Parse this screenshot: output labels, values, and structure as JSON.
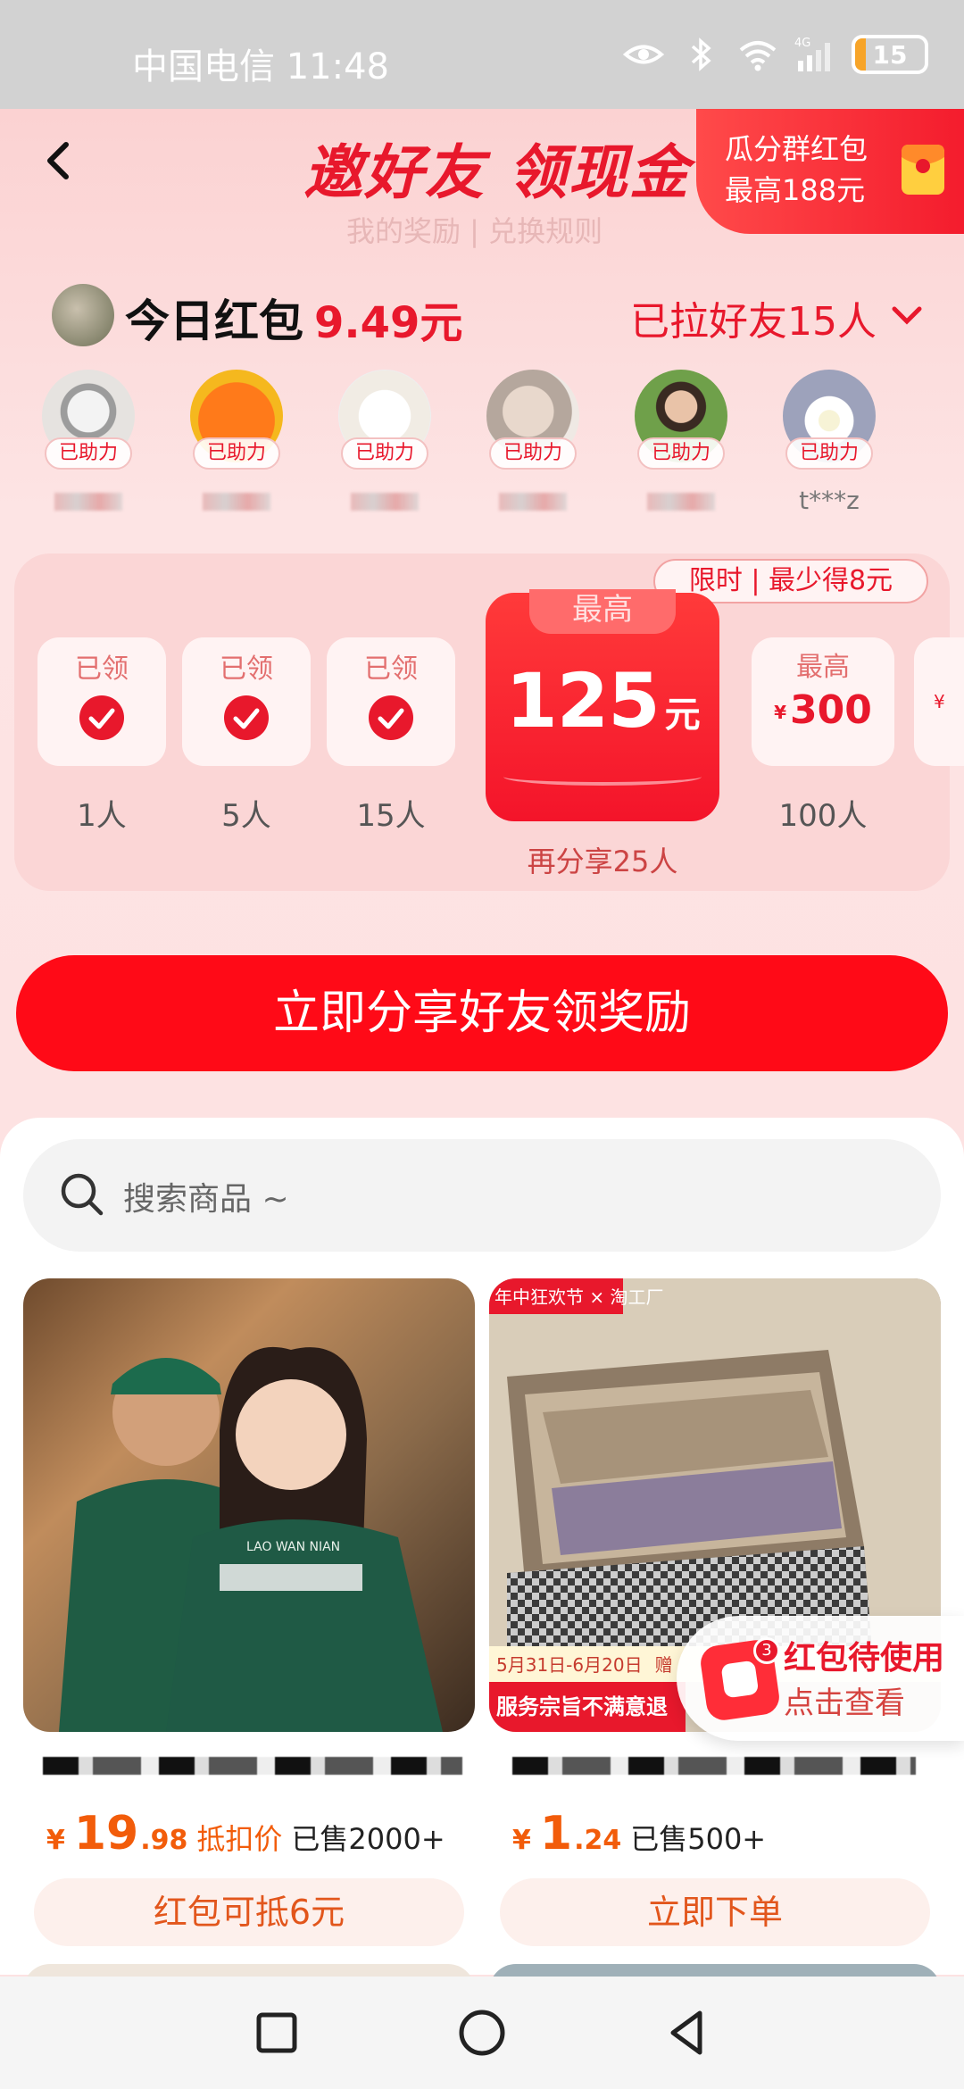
{
  "status_bar": {
    "carrier_time": "中国电信 11:48",
    "network": "4G",
    "battery_level": 15,
    "battery_text": "15"
  },
  "header": {
    "title": "邀好友 领现金",
    "subtitle": "我的奖励 | 兑换规则",
    "group_banner": {
      "line1": "瓜分群红包",
      "line2": "最高188元"
    }
  },
  "today": {
    "label": "今日红包",
    "amount": "9.49元",
    "friends": "已拉好友15人"
  },
  "helpers": [
    {
      "badge": "已助力",
      "name": "",
      "avatar_color": "#d9d6d3"
    },
    {
      "badge": "已助力",
      "name": "",
      "avatar_color": "#f58a1f"
    },
    {
      "badge": "已助力",
      "name": "",
      "avatar_color": "#f3efe8"
    },
    {
      "badge": "已助力",
      "name": "",
      "avatar_color": "#d8cfc8"
    },
    {
      "badge": "已助力",
      "name": "",
      "avatar_color": "#5c8f3a"
    },
    {
      "badge": "已助力",
      "name": "t***z",
      "avatar_color": "#b6b9c9"
    }
  ],
  "rewards": {
    "limit_tag": "限时 | 最少得8元",
    "steps": [
      {
        "label": "已领",
        "people": "1人"
      },
      {
        "label": "已领",
        "people": "5人"
      },
      {
        "label": "已领",
        "people": "15人"
      }
    ],
    "current": {
      "tab": "最高",
      "value": "125",
      "unit": "元",
      "note": "再分享25人"
    },
    "next": {
      "label": "最高",
      "yen": "¥",
      "value": "300",
      "people": "100人"
    },
    "peek_yen": "¥"
  },
  "share_button": "立即分享好友领奖励",
  "search": {
    "placeholder": "搜索商品 ~"
  },
  "products": [
    {
      "yen": "¥",
      "price_main": "19",
      "price_dec": ".98",
      "price_tag": "抵扣价",
      "sold": "已售2000+",
      "button": "红包可抵6元",
      "shirt_text": "LAO WAN NIAN"
    },
    {
      "yen": "¥",
      "price_main": "1",
      "price_dec": ".24",
      "price_tag": "",
      "sold": "已售500+",
      "button": "立即下单",
      "banner_top": "年中狂欢节 × 淘工厂",
      "banner_date": "5月31日-6月20日",
      "banner_date_tail": "赠",
      "banner_bottom": "服务宗旨不满意退"
    }
  ],
  "floating": {
    "badge": "3",
    "line1": "红包待使用",
    "line2": "点击查看"
  },
  "colors": {
    "brand_red": "#e8182c",
    "button_red": "#ff0a17",
    "price_orange": "#f25c0a"
  }
}
